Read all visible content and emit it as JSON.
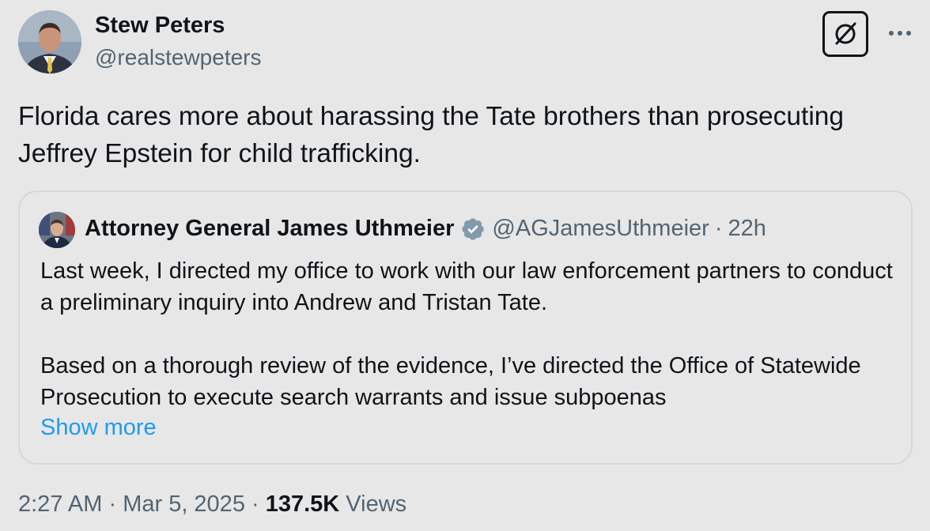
{
  "author": {
    "name": "Stew Peters",
    "handle": "@realstewpeters"
  },
  "tweet": {
    "text": "Florida cares more about harassing the Tate brothers than prosecuting Jeffrey Epstein for child trafficking."
  },
  "quote": {
    "name": "Attorney General James Uthmeier",
    "handle": "@AGJamesUthmeier",
    "separator": "·",
    "time": "22h",
    "paragraph_1": "Last week, I directed my office to work with our law enforcement partners to conduct a preliminary inquiry into Andrew and Tristan Tate.",
    "paragraph_2": "Based on a thorough review of the evidence, I’ve directed the Office of Statewide Prosecution to execute search warrants and issue subpoenas",
    "show_more": "Show more"
  },
  "meta": {
    "time": "2:27 AM",
    "separator_1": " · ",
    "date": "Mar 5, 2025",
    "separator_2": " · ",
    "views_count": "137.5K",
    "views_label": " Views"
  },
  "icons": {
    "grok": "grok-icon",
    "more": "more-icon",
    "verified": "verified-badge-icon"
  },
  "colors": {
    "background": "#e7e7e7",
    "text": "#0f1419",
    "secondary": "#536471",
    "link": "#1d9bf0",
    "badge": "#829aab"
  }
}
